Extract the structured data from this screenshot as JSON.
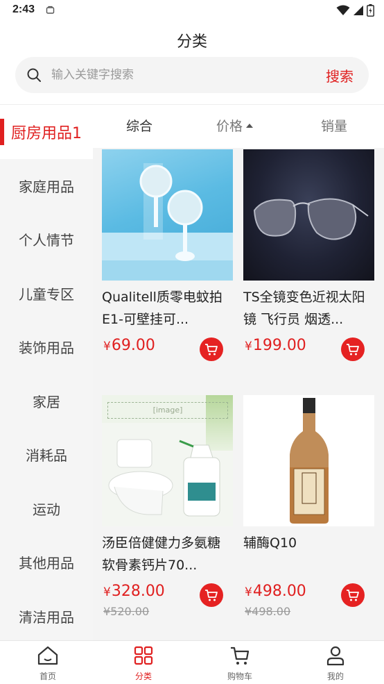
{
  "status_bar": {
    "time": "2:43"
  },
  "header": {
    "title": "分类"
  },
  "search": {
    "placeholder": "输入关键字搜索",
    "button_label": "搜索"
  },
  "sidebar": {
    "items": [
      {
        "label": "厨房用品1",
        "active": true
      },
      {
        "label": "家庭用品"
      },
      {
        "label": "个人情节"
      },
      {
        "label": "儿童专区"
      },
      {
        "label": "装饰用品"
      },
      {
        "label": "家居"
      },
      {
        "label": "消耗品"
      },
      {
        "label": "运动"
      },
      {
        "label": "其他用品"
      },
      {
        "label": "清洁用品"
      }
    ]
  },
  "sort": {
    "comprehensive": "综合",
    "price": "价格",
    "sales": "销量"
  },
  "products": [
    {
      "title": "Qualitell质零电蚊拍 E1-可壁挂可...",
      "currency": "¥",
      "price": "69.00",
      "image": "mosquito-racket-image"
    },
    {
      "title": "TS全镜变色近视太阳镜 飞行员 烟透...",
      "currency": "¥",
      "price": "199.00",
      "image": "sunglasses-image"
    },
    {
      "title": "汤臣倍健健力多氨糖软骨素钙片70...",
      "currency": "¥",
      "price": "328.00",
      "old_price": "¥520.00",
      "image": "toilet-cleaner-image"
    },
    {
      "title": "辅酶Q10",
      "currency": "¥",
      "price": "498.00",
      "old_price": "¥498.00",
      "image": "wine-bottle-image"
    }
  ],
  "tabbar": {
    "home": "首页",
    "category": "分类",
    "cart": "购物车",
    "mine": "我的"
  },
  "colors": {
    "accent": "#e02020",
    "sidebar_bg": "#f5f5f5",
    "grid_bg": "#f4f4f4"
  }
}
